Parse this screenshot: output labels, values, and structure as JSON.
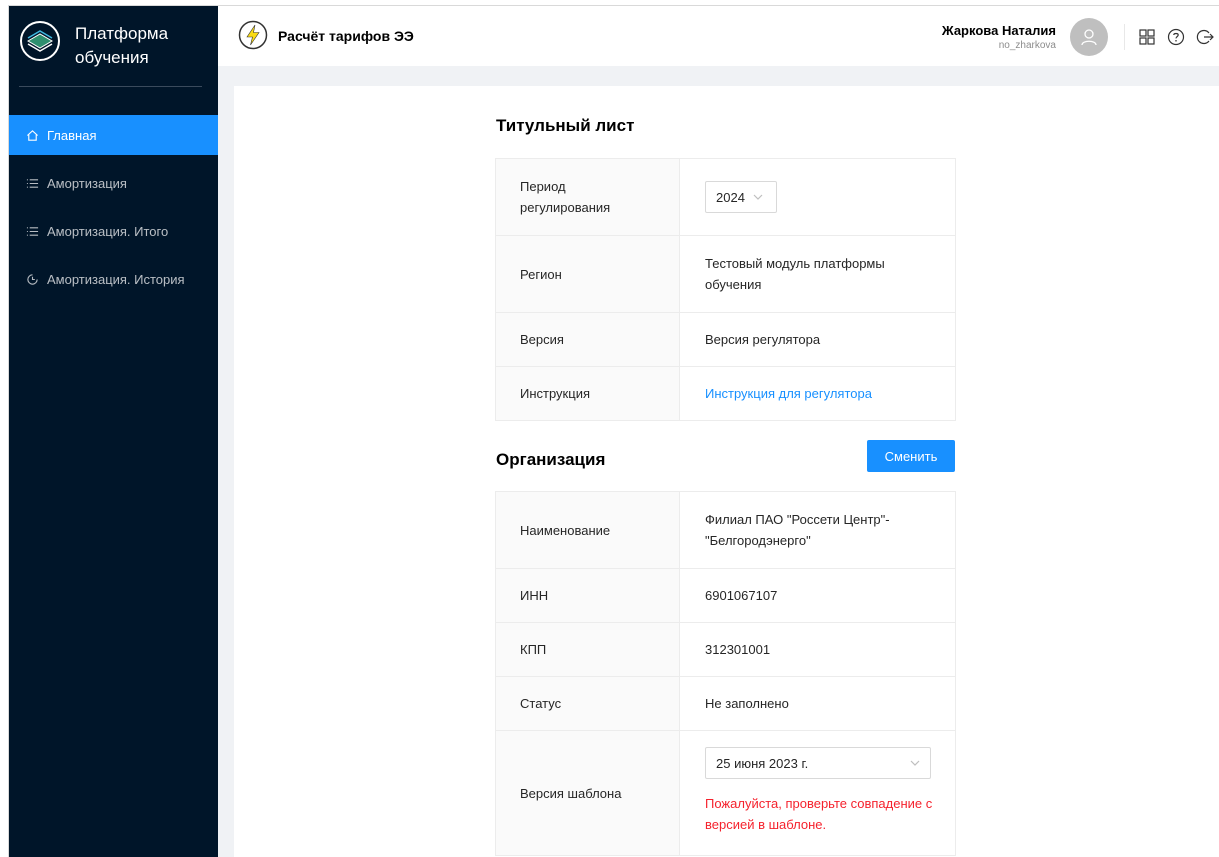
{
  "sidebar": {
    "logo_line1": "Платформа",
    "logo_line2": "обучения",
    "items": [
      {
        "label": "Главная",
        "active": true,
        "icon": "home-icon"
      },
      {
        "label": "Амортизация",
        "icon": "list-icon"
      },
      {
        "label": "Амортизация. Итого",
        "icon": "list-icon"
      },
      {
        "label": "Амортизация. История",
        "icon": "history-icon"
      }
    ]
  },
  "header": {
    "app_title": "Расчёт тарифов ЭЭ",
    "user_name": "Жаркова Наталия",
    "user_login": "no_zharkova"
  },
  "title_page": {
    "heading": "Титульный лист",
    "rows": {
      "period_label": "Период регулирования",
      "period_value": "2024",
      "region_label": "Регион",
      "region_value": "Тестовый модуль платформы обучения",
      "version_label": "Версия",
      "version_value": "Версия регулятора",
      "instruction_label": "Инструкция",
      "instruction_value": "Инструкция для регулятора"
    }
  },
  "organization": {
    "heading": "Организация",
    "change_button": "Сменить",
    "rows": {
      "name_label": "Наименование",
      "name_value": "Филиал ПАО \"Россети Центр\"-\"Белгородэнерго\"",
      "inn_label": "ИНН",
      "inn_value": "6901067107",
      "kpp_label": "КПП",
      "kpp_value": "312301001",
      "status_label": "Статус",
      "status_value": "Не заполнено",
      "template_label": "Версия шаблона",
      "template_value": "25 июня 2023 г.",
      "template_warning": "Пожалуйста, проверьте совпадение с версией в шаблоне."
    }
  },
  "colors": {
    "accent": "#1890ff",
    "sidebar_bg": "#001529",
    "error": "#f5222d",
    "app_icon": "#fadb14"
  }
}
